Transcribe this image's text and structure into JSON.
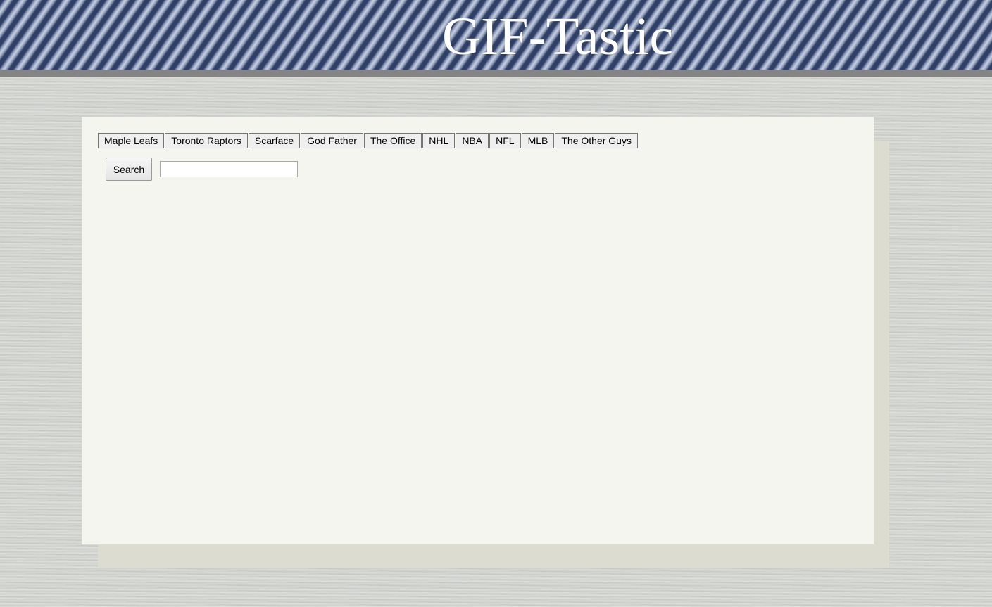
{
  "header": {
    "title": "GIF-Tastic"
  },
  "topics": [
    {
      "label": "Maple Leafs"
    },
    {
      "label": "Toronto Raptors"
    },
    {
      "label": "Scarface"
    },
    {
      "label": "God Father"
    },
    {
      "label": "The Office"
    },
    {
      "label": "NHL"
    },
    {
      "label": "NBA"
    },
    {
      "label": "NFL"
    },
    {
      "label": "MLB"
    },
    {
      "label": "The Other Guys"
    }
  ],
  "search": {
    "button_label": "Search",
    "value": "",
    "placeholder": ""
  },
  "colors": {
    "header_text": "#ffffff",
    "header_rule": "#848484",
    "panel": "#f5f5ef",
    "panel_shadow": "#dcdcd1"
  }
}
